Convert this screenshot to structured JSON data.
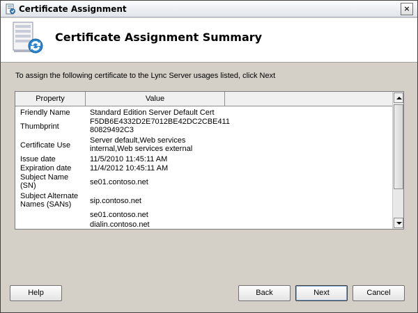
{
  "window": {
    "title": "Certificate Assignment",
    "close_glyph": "×"
  },
  "header": {
    "title": "Certificate Assignment Summary",
    "icon": "server-certificate-icon"
  },
  "instruction": "To assign the following certificate to the Lync Server usages listed, click Next",
  "table": {
    "columns": [
      "Property",
      "Value"
    ],
    "rows": [
      {
        "property": "Friendly Name",
        "value": "Standard Edition Server Default Cert"
      },
      {
        "property": "Thumbprint",
        "value": "F5DB6E4332D2E7012BE42DC2CBE411\n80829492C3"
      },
      {
        "property": "Certificate Use",
        "value": "Server default,Web services\ninternal,Web services external"
      },
      {
        "property": "Issue date",
        "value": "11/5/2010 11:45:11 AM"
      },
      {
        "property": "Expiration date",
        "value": "11/4/2012 10:45:11 AM"
      },
      {
        "property": "Subject Name\n(SN)",
        "value": "se01.contoso.net"
      },
      {
        "property": "Subject Alternate\nNames (SANs)",
        "value": "sip.contoso.net"
      },
      {
        "property": "",
        "value": "se01.contoso.net"
      },
      {
        "property": "",
        "value": "dialin.contoso.net"
      }
    ]
  },
  "buttons": {
    "help": "Help",
    "back": "Back",
    "next": "Next",
    "cancel": "Cancel"
  }
}
